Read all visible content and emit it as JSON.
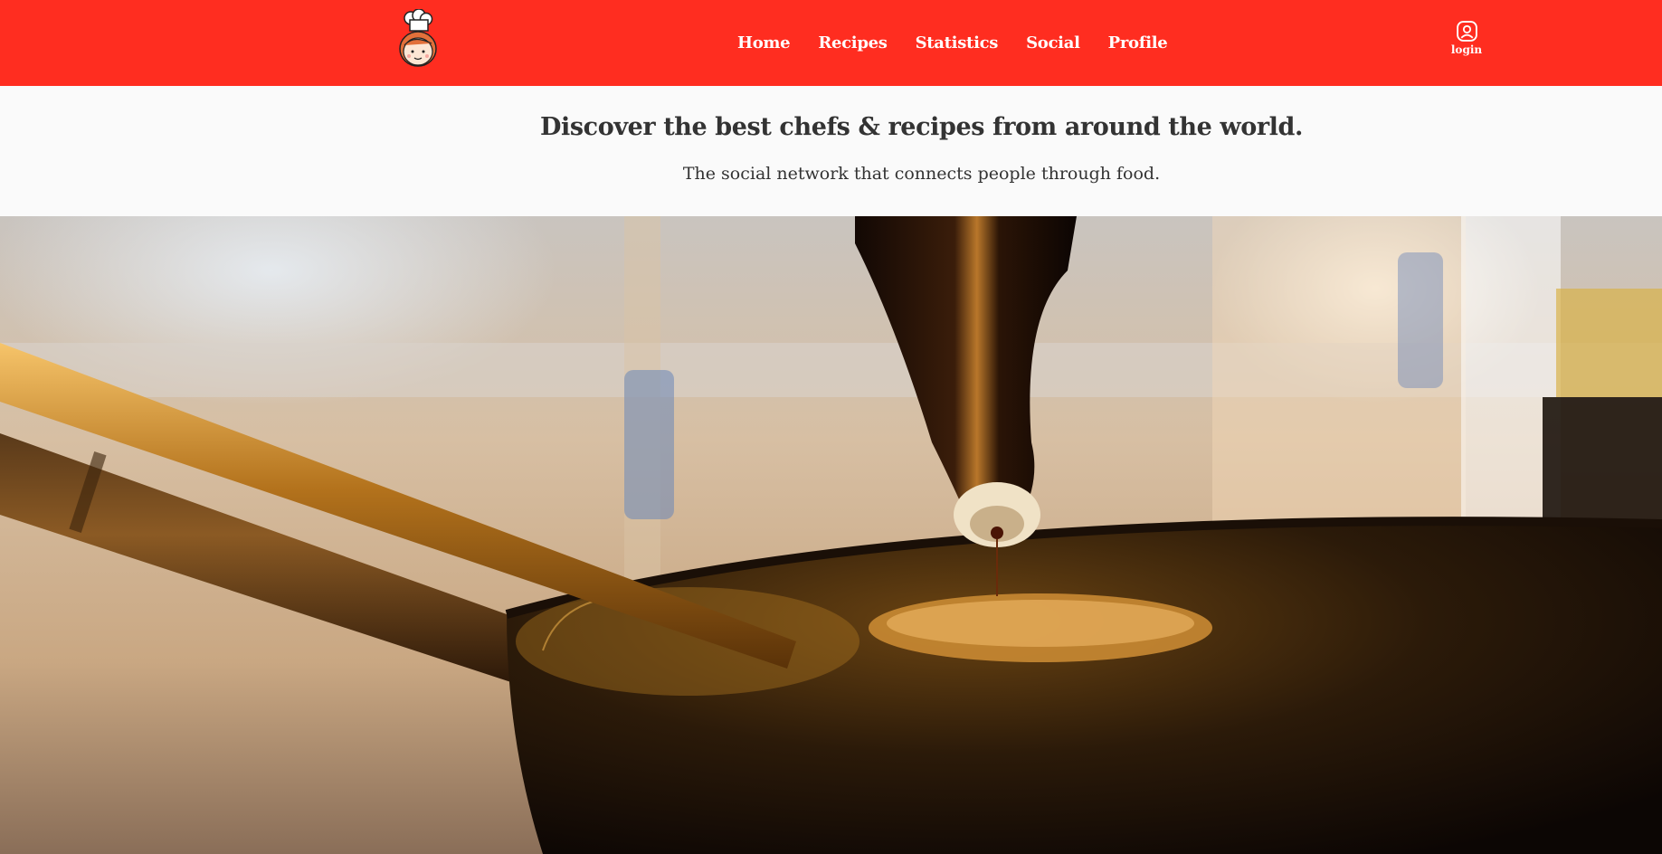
{
  "nav": {
    "items": [
      {
        "label": "Home"
      },
      {
        "label": "Recipes"
      },
      {
        "label": "Statistics"
      },
      {
        "label": "Social"
      },
      {
        "label": "Profile"
      }
    ],
    "login_label": "login"
  },
  "hero": {
    "headline": "Discover the best chefs & recipes from around the world.",
    "subline": "The social network that connects people through food."
  },
  "colors": {
    "brand_red": "#ff2d20",
    "text_dark": "#333333",
    "band_bg": "#fafafa"
  },
  "icons": {
    "logo": "chef-girl-logo-icon",
    "login": "user-circle-icon"
  }
}
